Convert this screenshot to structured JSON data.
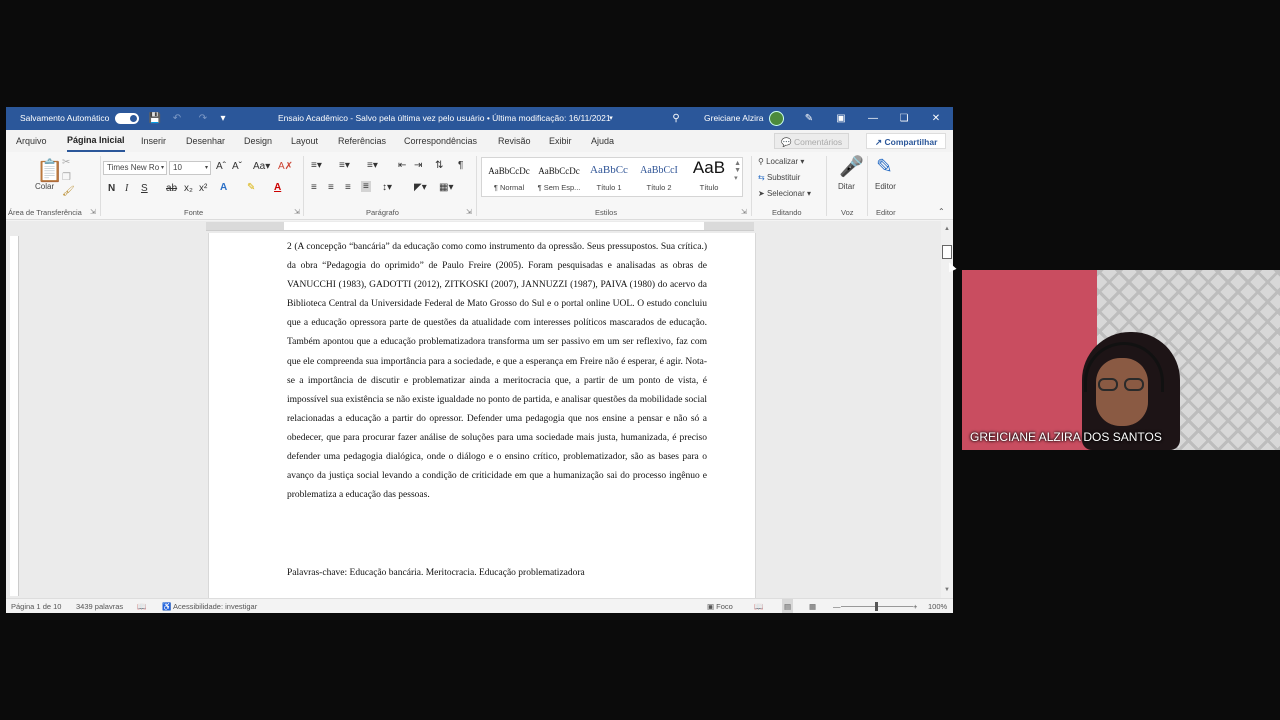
{
  "titlebar": {
    "autosave_label": "Salvamento Automático",
    "doc_title": "Ensaio Acadêmico  -  Salvo pela última vez pelo usuário • Última modificação: 16/11/2021",
    "user_name": "Greiciane Alzira"
  },
  "tabs": [
    "Arquivo",
    "Página Inicial",
    "Inserir",
    "Desenhar",
    "Design",
    "Layout",
    "Referências",
    "Correspondências",
    "Revisão",
    "Exibir",
    "Ajuda"
  ],
  "tab_actions": {
    "comments": "Comentários",
    "share": "Compartilhar"
  },
  "ribbon": {
    "clipboard": {
      "paste": "Colar",
      "label": "Área de Transferência"
    },
    "font": {
      "family": "Times New Ro",
      "size": "10",
      "label": "Fonte",
      "bold": "N",
      "italic": "I",
      "underline": "S"
    },
    "paragraph": {
      "label": "Parágrafo"
    },
    "styles": {
      "label": "Estilos",
      "items": [
        {
          "preview": "AaBbCcDc",
          "name": "¶ Normal"
        },
        {
          "preview": "AaBbCcDc",
          "name": "¶ Sem Esp..."
        },
        {
          "preview": "AaBbCc",
          "name": "Título 1"
        },
        {
          "preview": "AaBbCcI",
          "name": "Título 2"
        },
        {
          "preview": "AaB",
          "name": "Título"
        }
      ]
    },
    "editing": {
      "find": "Localizar",
      "replace": "Substituir",
      "select": "Selecionar",
      "label": "Editando"
    },
    "voice": {
      "dictate": "Ditar",
      "label": "Voz"
    },
    "editor": {
      "editor": "Editor",
      "label": "Editor"
    }
  },
  "document": {
    "paragraph": "2 (A concepção “bancária” da educação como como instrumento da opressão. Seus pressupostos. Sua crítica.) da obra “Pedagogia do oprimido” de Paulo Freire (2005). Foram pesquisadas e analisadas as obras de VANUCCHI (1983), GADOTTI (2012), ZITKOSKI (2007), JANNUZZI (1987), PAIVA (1980) do acervo da Biblioteca Central da Universidade Federal de Mato Grosso do Sul e o portal online UOL. O estudo concluiu que a educação opressora parte de questões da atualidade com interesses políticos mascarados de educação. Também apontou que a educação problematizadora transforma um ser passivo em um ser reflexivo, faz com que ele compreenda sua importância para a sociedade, e que a esperança em Freire não é esperar, é agir. Nota-se a importância de discutir e problematizar ainda a meritocracia que, a partir de um ponto de vista, é impossível sua existência se não existe igualdade no ponto de partida, e analisar questões da mobilidade social relacionadas a educação a partir do opressor. Defender uma pedagogia que nos ensine a pensar e não só a obedecer, que para procurar fazer análise de soluções para uma sociedade mais justa, humanizada, é preciso defender uma pedagogia dialógica, onde o diálogo e o ensino crítico, problematizador, são as bases para o avanço da justiça social levando a condição de criticidade em que a humanização sai do processo ingênuo e problematiza a educação das pessoas.",
    "keywords": "Palavras-chave: Educação bancária. Meritocracia. Educação problematizadora"
  },
  "statusbar": {
    "page": "Página 1 de 10",
    "words": "3439 palavras",
    "accessibility": "Acessibilidade: investigar",
    "focus": "Foco",
    "zoom": "100%"
  },
  "webcam": {
    "participant_name": "GREICIANE ALZIRA DOS SANTOS"
  }
}
